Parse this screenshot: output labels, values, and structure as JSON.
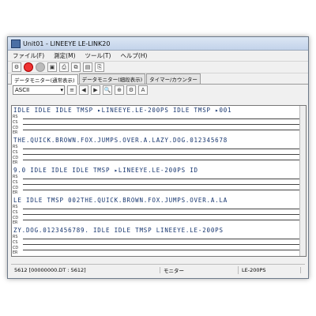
{
  "window": {
    "title": "Unit01 - LINEEYE LE-LINK20"
  },
  "menu": [
    "ファイル(F)",
    "測定(M)",
    "ツール(T)",
    "ヘルプ(H)"
  ],
  "tabs": [
    "データモニター(通常表示)",
    "データモニター(細段表示)",
    "タイマー/カウンター"
  ],
  "code_select": "ASCII",
  "rows": [
    "IDLE  IDLE  IDLE  TMSP ▸LINEEYE.LE-200PS  IDLE TMSP ▸001",
    "THE.QUICK.BROWN.FOX.JUMPS.OVER.A.LAZY.DOG.012345678",
    "9.0  IDLE  IDLE  IDLE  TMSP ▸LINEEYE.LE-200PS  ID",
    "LE  IDLE TMSP 002THE.QUICK.BROWN.FOX.JUMPS.OVER.A.LA",
    "ZY.DOG.0123456789.  IDLE  IDLE TMSP LINEEYE.LE-200PS"
  ],
  "status": {
    "count": "5612 [00000000.DT : 5612]",
    "mode": "モニター",
    "model": "LE-200PS"
  }
}
